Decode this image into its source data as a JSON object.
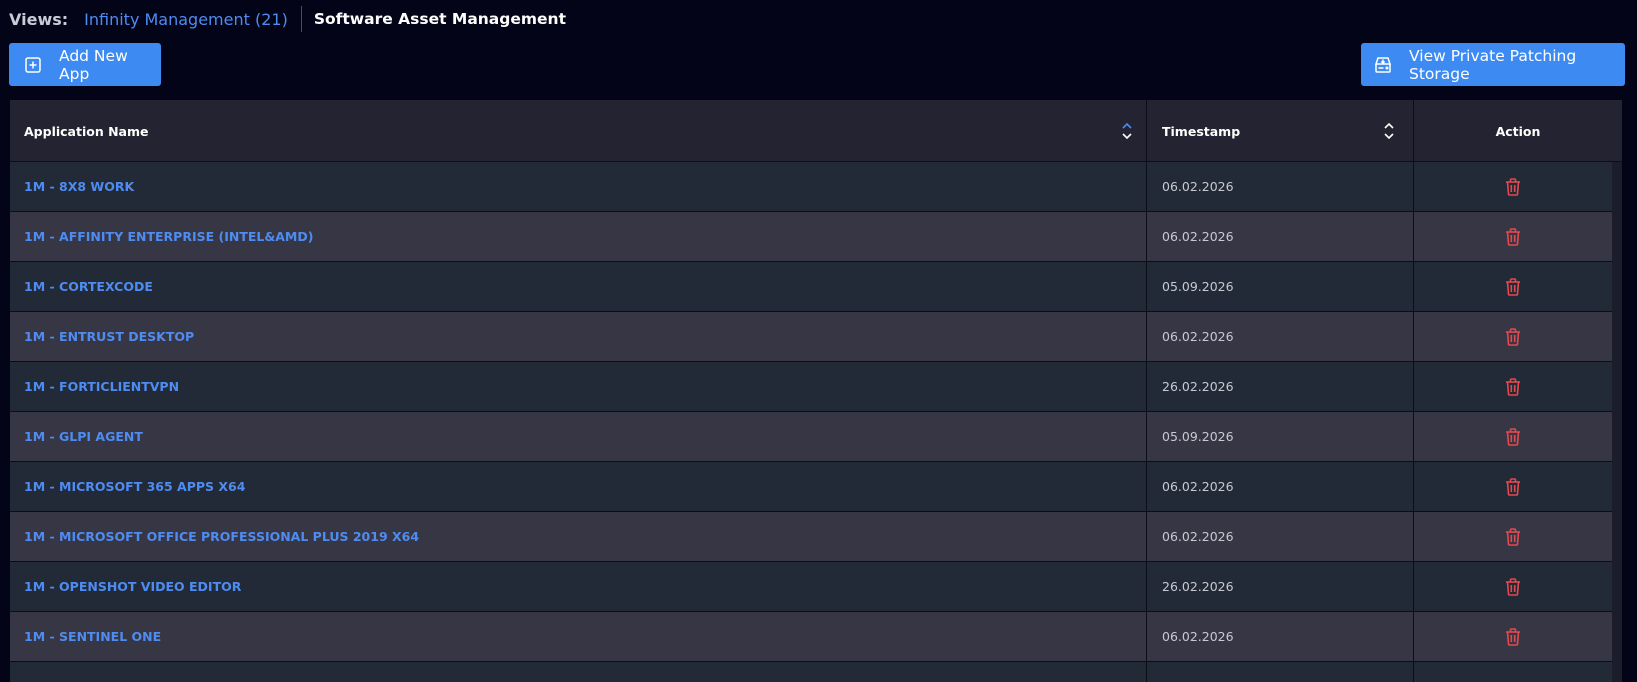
{
  "views": {
    "label": "Views:",
    "infinity": "Infinity Management (21)",
    "current": "Software Asset Management"
  },
  "toolbar": {
    "add_label": "Add New App",
    "storage_label": "View Private Patching Storage"
  },
  "table": {
    "columns": [
      "Application Name",
      "Timestamp",
      "Action"
    ],
    "rows": [
      {
        "name": "1M - 8X8 WORK",
        "timestamp": "06.02.2026"
      },
      {
        "name": "1M - AFFINITY ENTERPRISE (INTEL&AMD)",
        "timestamp": "06.02.2026"
      },
      {
        "name": "1M - CORTEXCODE",
        "timestamp": "05.09.2026"
      },
      {
        "name": "1M - ENTRUST DESKTOP",
        "timestamp": "06.02.2026"
      },
      {
        "name": "1M - FORTICLIENTVPN",
        "timestamp": "26.02.2026"
      },
      {
        "name": "1M - GLPI AGENT",
        "timestamp": "05.09.2026"
      },
      {
        "name": "1M - MICROSOFT 365 APPS X64",
        "timestamp": "06.02.2026"
      },
      {
        "name": "1M - MICROSOFT OFFICE PROFESSIONAL PLUS 2019 X64",
        "timestamp": "06.02.2026"
      },
      {
        "name": "1M - OPENSHOT VIDEO EDITOR",
        "timestamp": "26.02.2026"
      },
      {
        "name": "1M - SENTINEL ONE",
        "timestamp": "06.02.2026"
      },
      {
        "name": "",
        "timestamp": ""
      }
    ]
  },
  "colors": {
    "background": "#030418",
    "accent": "#3d8bf2",
    "link": "#4e8cf2",
    "delete": "#e5484d"
  },
  "icons": {
    "add": "plus-square-icon",
    "storage": "storage-icon",
    "sort": "sort-icon",
    "delete": "trash-icon"
  }
}
